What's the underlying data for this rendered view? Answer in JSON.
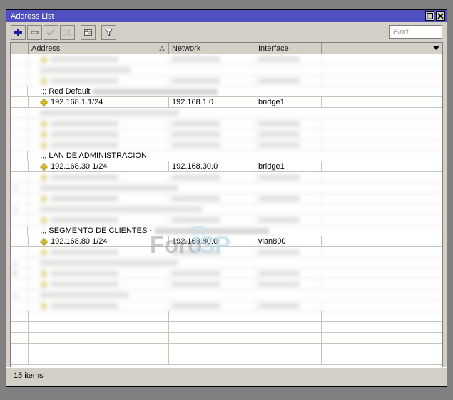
{
  "window": {
    "title": "Address List",
    "buttons": [
      {
        "name": "maximize-button",
        "label": "maximize"
      },
      {
        "name": "close-button",
        "label": "close"
      }
    ]
  },
  "toolbar": {
    "buttons": [
      {
        "name": "add-button",
        "icon": "plus-icon",
        "label": "Add",
        "enabled": true
      },
      {
        "name": "remove-button",
        "icon": "minus-icon",
        "label": "Remove",
        "enabled": true
      },
      {
        "name": "enable-button",
        "icon": "check-icon",
        "label": "Enable",
        "enabled": false
      },
      {
        "name": "disable-button",
        "icon": "cross-icon",
        "label": "Disable",
        "enabled": false
      },
      {
        "name": "comment-button",
        "icon": "comment-icon",
        "label": "Comment",
        "enabled": true
      },
      {
        "name": "filter-button",
        "icon": "filter-icon",
        "label": "Filter",
        "enabled": true
      }
    ],
    "find": {
      "placeholder": "Find",
      "value": ""
    }
  },
  "table": {
    "columns": [
      {
        "key": "flags",
        "label": ""
      },
      {
        "key": "address",
        "label": "Address",
        "sorted": "ascending"
      },
      {
        "key": "network",
        "label": "Network"
      },
      {
        "key": "interface",
        "label": "Interface"
      },
      {
        "key": "extra",
        "label": ""
      }
    ],
    "column_menu_icon": "chevron-down-icon",
    "rows": [
      {
        "type": "address",
        "flags": "",
        "address": "",
        "network": "",
        "interface": "",
        "blurred": true
      },
      {
        "type": "comment",
        "flags": "",
        "comment": "",
        "blurred": true
      },
      {
        "type": "address",
        "flags": "",
        "address": "",
        "network": "",
        "interface": "",
        "blurred": true
      },
      {
        "type": "comment",
        "flags": "",
        "comment": ";;; Red Default",
        "redacted_tail": true,
        "blurred": false
      },
      {
        "type": "address",
        "flags": "",
        "address": "192.168.1.1/24",
        "network": "192.168.1.0",
        "interface": "bridge1",
        "blurred": false
      },
      {
        "type": "comment",
        "flags": "",
        "comment": "",
        "blurred": true
      },
      {
        "type": "address",
        "flags": "",
        "address": "",
        "network": "",
        "interface": "",
        "blurred": true
      },
      {
        "type": "address",
        "flags": "",
        "address": "",
        "network": "",
        "interface": "",
        "blurred": true
      },
      {
        "type": "address",
        "flags": "",
        "address": "",
        "network": "",
        "interface": "",
        "blurred": true
      },
      {
        "type": "comment",
        "flags": "",
        "comment": ";;; LAN DE ADMINISTRACION",
        "redacted_tail": false,
        "blurred": false
      },
      {
        "type": "address",
        "flags": "",
        "address": "192.168.30.1/24",
        "network": "192.168.30.0",
        "interface": "bridge1",
        "blurred": false
      },
      {
        "type": "address",
        "flags": "",
        "address": "",
        "network": "",
        "interface": "",
        "blurred": true
      },
      {
        "type": "comment",
        "flags": ";;",
        "comment": "",
        "blurred": true
      },
      {
        "type": "address",
        "flags": "",
        "address": "",
        "network": "",
        "interface": "",
        "blurred": true
      },
      {
        "type": "comment",
        "flags": ";;",
        "comment": "",
        "blurred": true
      },
      {
        "type": "address",
        "flags": "",
        "address": "",
        "network": "",
        "interface": "",
        "blurred": true
      },
      {
        "type": "comment",
        "flags": "",
        "comment": ";;; SEGMENTO DE CLIENTES -",
        "redacted_tail": true,
        "blurred": false
      },
      {
        "type": "address",
        "flags": "",
        "address": "192.168.80.1/24",
        "network": "192.168.80.0",
        "interface": "vlan800",
        "blurred": false
      },
      {
        "type": "address",
        "flags": "",
        "address": "",
        "network": "",
        "interface": "",
        "blurred": true
      },
      {
        "type": "comment",
        "flags": ";;",
        "comment": "",
        "blurred": true
      },
      {
        "type": "address",
        "flags": "X",
        "address": "",
        "network": "",
        "interface": "",
        "blurred": true
      },
      {
        "type": "address",
        "flags": "",
        "address": "",
        "network": "",
        "interface": "",
        "blurred": true
      },
      {
        "type": "comment",
        "flags": ";;",
        "comment": "",
        "blurred": true
      },
      {
        "type": "address",
        "flags": "",
        "address": "",
        "network": "",
        "interface": "",
        "blurred": true
      }
    ],
    "empty_rows": 5
  },
  "watermark": {
    "text_primary": "Foro",
    "text_secondary": "ISP",
    "color_primary": "#9a9a9a",
    "color_secondary": "#b9d8ec"
  },
  "status": {
    "items_text": "15 items"
  },
  "colors": {
    "titlebar": "#4f4fbf",
    "chrome": "#d4d0c8",
    "desktop": "#808080",
    "header_line": "#9a9689",
    "grid_line": "#c8c4bb",
    "address_icon": "#e3c11a",
    "add_icon": "#1b1ba8"
  }
}
